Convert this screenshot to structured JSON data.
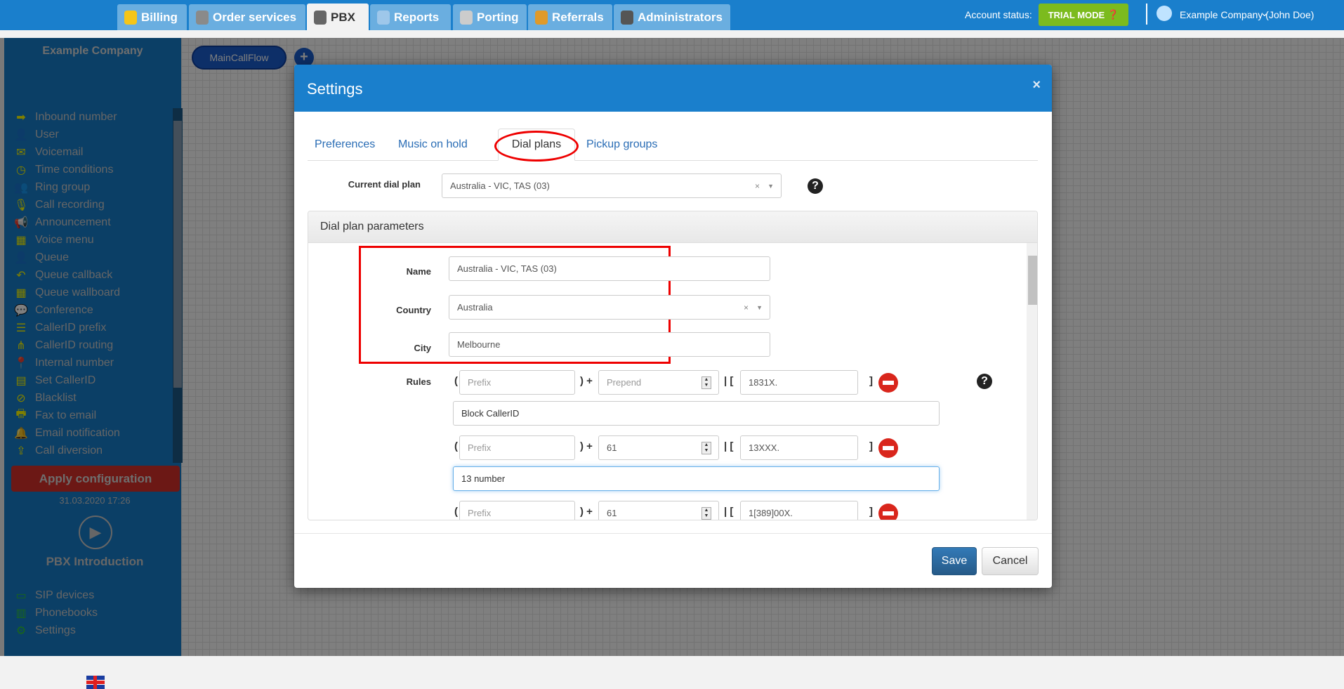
{
  "nav": {
    "tabs": [
      {
        "label": "Billing",
        "icon": "coins-icon",
        "color": "#f5c518"
      },
      {
        "label": "Order services",
        "icon": "cart-icon",
        "color": "#8a8a8a"
      },
      {
        "label": "PBX",
        "icon": "pbx-icon",
        "color": "#666666"
      },
      {
        "label": "Reports",
        "icon": "report-icon",
        "color": "#9ec7ea"
      },
      {
        "label": "Porting",
        "icon": "phone-icon",
        "color": "#cccccc"
      },
      {
        "label": "Referrals",
        "icon": "person-icon",
        "color": "#e09a2a"
      },
      {
        "label": "Administrators",
        "icon": "admin-icon",
        "color": "#555555"
      }
    ],
    "active": "PBX",
    "account_status_label": "Account status:",
    "trial_label": "TRIAL MODE",
    "user": "Example Company (John Doe)"
  },
  "sidebar": {
    "company": "Example Company",
    "items": [
      "Inbound number",
      "User",
      "Voicemail",
      "Time conditions",
      "Ring group",
      "Call recording",
      "Announcement",
      "Voice menu",
      "Queue",
      "Queue callback",
      "Queue wallboard",
      "Conference",
      "CallerID prefix",
      "CallerID routing",
      "Internal number",
      "Set CallerID",
      "Blacklist",
      "Fax to email",
      "Email notification",
      "Call diversion"
    ],
    "icons": [
      "➡",
      "👤",
      "✉",
      "◷",
      "👥",
      "🎙",
      "📢",
      "▦",
      "👤",
      "↶",
      "▦",
      "💬",
      "☰",
      "⋔",
      "📍",
      "▤",
      "⊘",
      "🖶",
      "🔔",
      "⇪"
    ],
    "apply_label": "Apply configuration",
    "last_applied": "31.03.2020 17:26",
    "intro_label": "PBX Introduction",
    "bottom_items": [
      {
        "label": "SIP devices",
        "icon": "▭"
      },
      {
        "label": "Phonebooks",
        "icon": "▥"
      },
      {
        "label": "Settings",
        "icon": "⚙"
      }
    ]
  },
  "canvas": {
    "flow_tab": "MainCallFlow",
    "add_label": "+"
  },
  "modal": {
    "title": "Settings",
    "close": "×",
    "tabs": [
      "Preferences",
      "Music on hold",
      "Dial plans",
      "Pickup groups"
    ],
    "active_tab": "Dial plans",
    "current_label": "Current dial plan",
    "current_value": "Australia - VIC, TAS (03)",
    "help": "?",
    "panel_title": "Dial plan parameters",
    "name_label": "Name",
    "name_value": "Australia - VIC, TAS (03)",
    "country_label": "Country",
    "country_value": "Australia",
    "city_label": "City",
    "city_value": "Melbourne",
    "rules_label": "Rules",
    "prefix_placeholder": "Prefix",
    "prepend_placeholder": "Prepend",
    "rules": [
      {
        "prepend": "",
        "pattern": "1831X.",
        "description": "Block CallerID"
      },
      {
        "prepend": "61",
        "pattern": "13XXX.",
        "description": "13 number"
      },
      {
        "prepend": "61",
        "pattern": "1[389]00X.",
        "description": ""
      }
    ],
    "save": "Save",
    "cancel": "Cancel"
  }
}
